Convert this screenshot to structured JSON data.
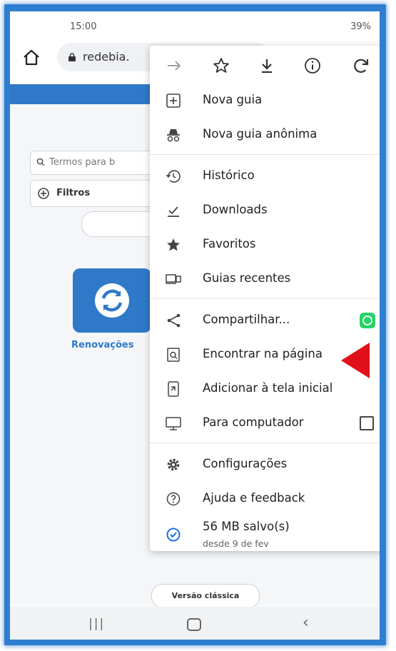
{
  "status_bar": {
    "time": "15:00",
    "battery": "39%"
  },
  "browser": {
    "url": "redebia."
  },
  "page": {
    "search_placeholder": "Termos para b",
    "filter_label": "Filtros",
    "tile_label": "Renovações",
    "classic_button": "Versão clássica"
  },
  "menu": {
    "items": [
      {
        "label": "Nova guia",
        "icon": "plus-box-icon"
      },
      {
        "label": "Nova guia anônima",
        "icon": "incognito-icon"
      },
      {
        "label": "Histórico",
        "icon": "history-icon"
      },
      {
        "label": "Downloads",
        "icon": "download-icon"
      },
      {
        "label": "Favoritos",
        "icon": "star-icon"
      },
      {
        "label": "Guias recentes",
        "icon": "recent-tabs-icon"
      },
      {
        "label": "Compartilhar...",
        "icon": "share-icon"
      },
      {
        "label": "Encontrar na página",
        "icon": "find-in-page-icon"
      },
      {
        "label": "Adicionar à tela inicial",
        "icon": "add-to-home-icon"
      },
      {
        "label": "Para computador",
        "icon": "desktop-icon"
      },
      {
        "label": "Configurações",
        "icon": "gear-icon"
      },
      {
        "label": "Ajuda e feedback",
        "icon": "help-icon"
      }
    ],
    "saved": {
      "title": "56 MB salvo(s)",
      "subtitle": "desde 9 de fev"
    }
  },
  "colors": {
    "brand_blue": "#2f79c8",
    "highlight_arrow": "#e0101a",
    "whatsapp_green": "#25d366"
  }
}
